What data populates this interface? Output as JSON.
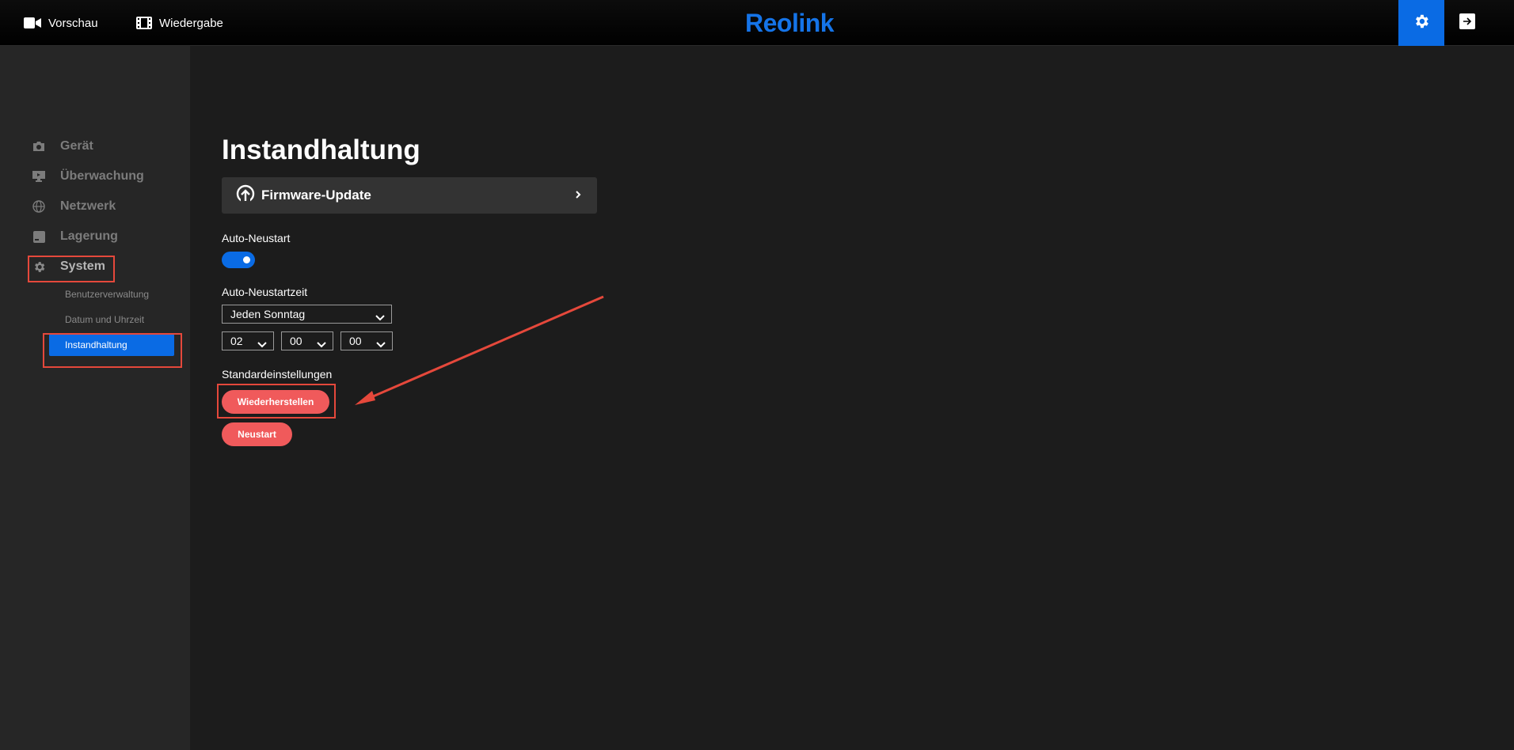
{
  "topbar": {
    "preview_label": "Vorschau",
    "playback_label": "Wiedergabe",
    "logo_text": "Reolink",
    "active_color": "#0a6be4"
  },
  "sidebar": {
    "items": [
      {
        "label": "Gerät",
        "icon": "camera-icon"
      },
      {
        "label": "Überwachung",
        "icon": "monitor-icon"
      },
      {
        "label": "Netzwerk",
        "icon": "globe-icon"
      },
      {
        "label": "Lagerung",
        "icon": "storage-icon"
      },
      {
        "label": "System",
        "icon": "gear-icon"
      }
    ],
    "sub_items": [
      {
        "label": "Benutzerverwaltung"
      },
      {
        "label": "Datum und Uhrzeit"
      },
      {
        "label": "Instandhaltung"
      }
    ]
  },
  "main": {
    "title": "Instandhaltung",
    "firmware_label": "Firmware-Update",
    "auto_restart_label": "Auto-Neustart",
    "auto_restart_enabled": true,
    "restart_time_label": "Auto-Neustartzeit",
    "restart_day": "Jeden Sonntag",
    "restart_hour": "02",
    "restart_minute": "00",
    "restart_second": "00",
    "defaults_label": "Standardeinstellungen",
    "restore_button": "Wiederherstellen",
    "restart_button": "Neustart",
    "danger_color": "#f05a5b"
  }
}
